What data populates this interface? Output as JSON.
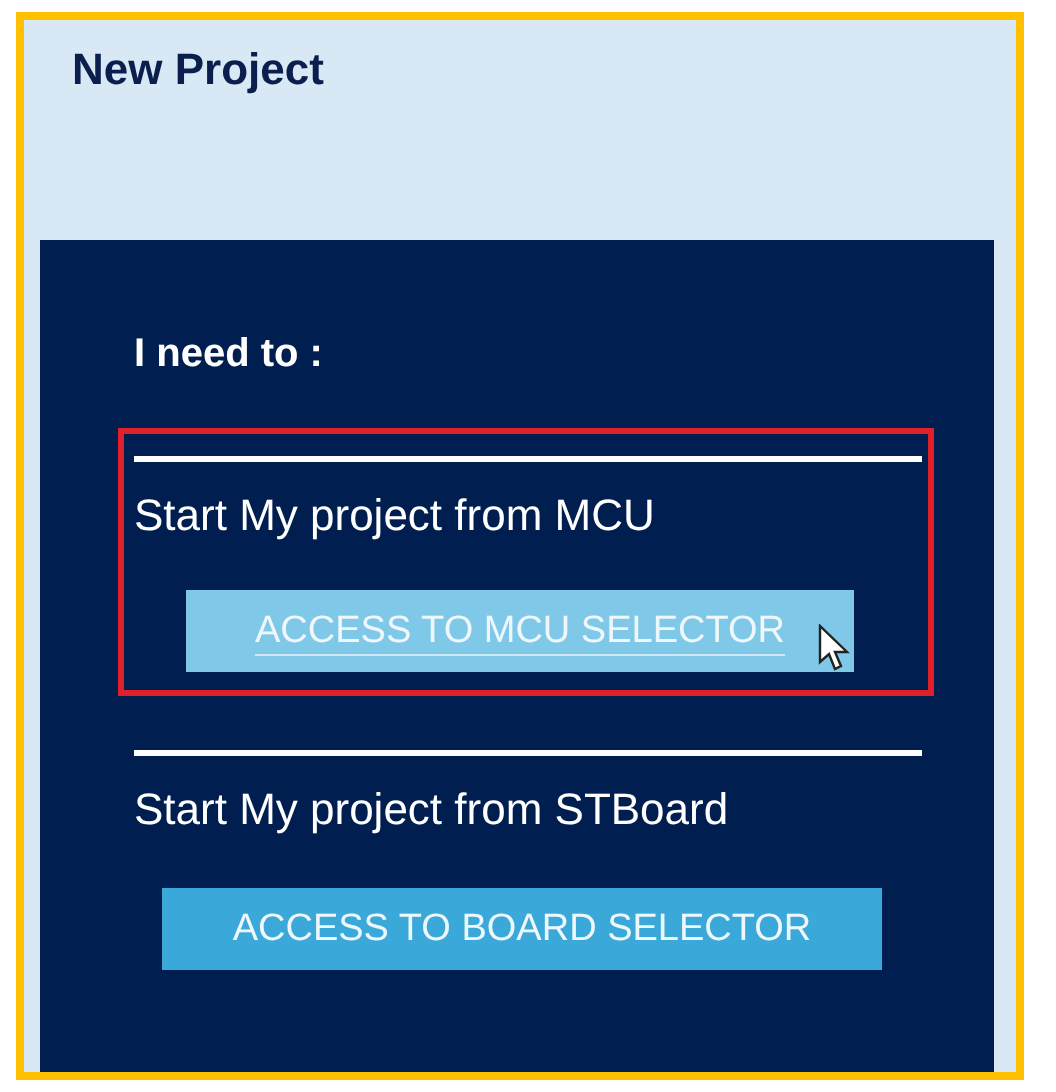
{
  "window": {
    "title": "New Project"
  },
  "panel": {
    "heading": "I need to :",
    "options": [
      {
        "label": "Start My project from MCU",
        "button": "ACCESS TO MCU SELECTOR",
        "hovered": true,
        "highlighted": true
      },
      {
        "label": "Start My project from STBoard",
        "button": "ACCESS TO BOARD SELECTOR",
        "hovered": false,
        "highlighted": false
      }
    ]
  }
}
